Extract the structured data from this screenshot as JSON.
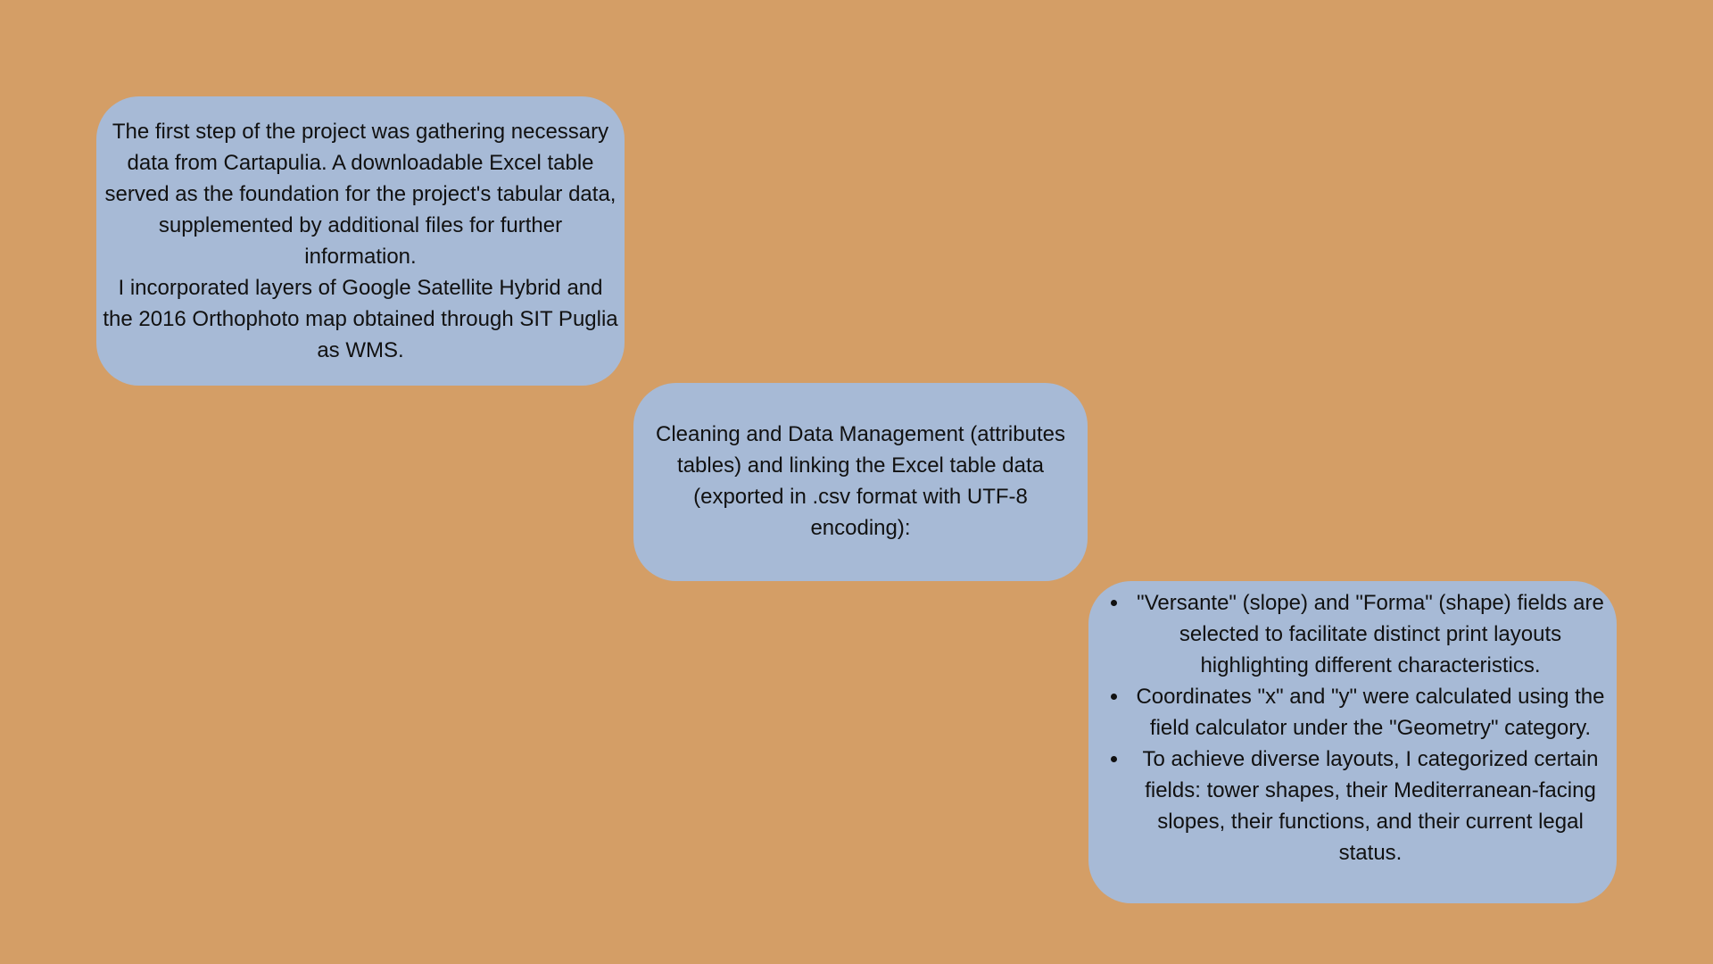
{
  "colors": {
    "background": "#d49e66",
    "card": "#a7bad6",
    "text": "#111111"
  },
  "card_1": {
    "paragraph_1": "The first step of the project was gathering necessary data from Cartapulia. A downloadable Excel table served as the foundation for the project's tabular data, supplemented by additional files for further information.",
    "paragraph_2": "I incorporated layers of Google Satellite Hybrid and the 2016 Orthophoto map obtained through SIT Puglia as WMS."
  },
  "card_2": {
    "text": "Cleaning and Data Management (attributes tables) and linking the Excel table data (exported in .csv format with UTF-8 encoding):"
  },
  "card_3": {
    "bullets": [
      "\"Versante\" (slope) and \"Forma\" (shape) fields are selected to facilitate distinct print layouts highlighting different characteristics.",
      "Coordinates \"x\" and \"y\" were calculated using the field calculator under the \"Geometry\" category.",
      "To achieve diverse layouts, I categorized certain fields: tower shapes, their Mediterranean-facing slopes, their functions, and their current legal status."
    ]
  }
}
